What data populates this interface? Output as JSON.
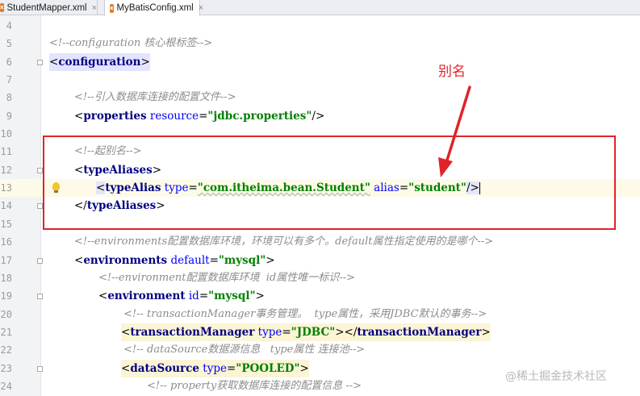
{
  "tabs": [
    {
      "label": "StudentMapper.xml",
      "icon": "xml-file-icon"
    },
    {
      "label": "MyBatisConfig.xml",
      "icon": "xml-file-icon",
      "active": true
    }
  ],
  "lines": {
    "l4": {
      "num": "4"
    },
    "l5": {
      "num": "5",
      "comment": "<!--configuration 核心根标签-->"
    },
    "l6": {
      "num": "6",
      "open": "<",
      "name": "configuration",
      "close": ">"
    },
    "l7": {
      "num": "7"
    },
    "l8": {
      "num": "8",
      "comment": "<!--引入数据库连接的配置文件-->"
    },
    "l9": {
      "num": "9",
      "open": "<",
      "name": "properties",
      "attr": "resource",
      "eq": "=",
      "value": "\"jdbc.properties\"",
      "close": "/>"
    },
    "l10": {
      "num": "10"
    },
    "l11": {
      "num": "11",
      "comment": "<!--起别名-->"
    },
    "l12": {
      "num": "12",
      "open": "<",
      "name": "typeAliases",
      "close": ">"
    },
    "l13": {
      "num": "13",
      "open": "<",
      "name": "typeAlias",
      "attr1": "type",
      "value1": "\"com.itheima.bean.Student\"",
      "attr2": "alias",
      "value2": "\"student\"",
      "close": "/>"
    },
    "l14": {
      "num": "14",
      "open": "</",
      "name": "typeAliases",
      "close": ">"
    },
    "l15": {
      "num": "15"
    },
    "l16": {
      "num": "16",
      "comment": "<!--environments配置数据库环境，环境可以有多个。default属性指定使用的是哪个-->"
    },
    "l17": {
      "num": "17",
      "open": "<",
      "name": "environments",
      "attr": "default",
      "eq": "=",
      "value": "\"mysql\"",
      "close": ">"
    },
    "l18": {
      "num": "18",
      "comment": "<!--environment配置数据库环境  id属性唯一标识-->"
    },
    "l19": {
      "num": "19",
      "open": "<",
      "name": "environment",
      "attr": "id",
      "eq": "=",
      "value": "\"mysql\"",
      "close": ">"
    },
    "l20": {
      "num": "20",
      "comment": "<!-- transactionManager事务管理。  type属性，采用JDBC默认的事务-->"
    },
    "l21": {
      "num": "21",
      "open": "<",
      "name": "transactionManager",
      "attr": "type",
      "eq": "=",
      "value": "\"JDBC\"",
      "mid": "></",
      "name2": "transactionManager",
      "close": ">"
    },
    "l22": {
      "num": "22",
      "comment": "<!-- dataSource数据源信息   type属性 连接池-->"
    },
    "l23": {
      "num": "23",
      "open": "<",
      "name": "dataSource",
      "attr": "type",
      "eq": "=",
      "value": "\"POOLED\"",
      "close": ">"
    },
    "l24": {
      "num": "24",
      "comment": "<!-- property获取数据库连接的配置信息 -->"
    }
  },
  "annotation": "别名",
  "watermark": "@稀土掘金技术社区",
  "colors": {
    "accent_red": "#e0232a",
    "tag": "#000080",
    "attr": "#0000ff",
    "value": "#008000",
    "comment": "#8c8c8c"
  }
}
